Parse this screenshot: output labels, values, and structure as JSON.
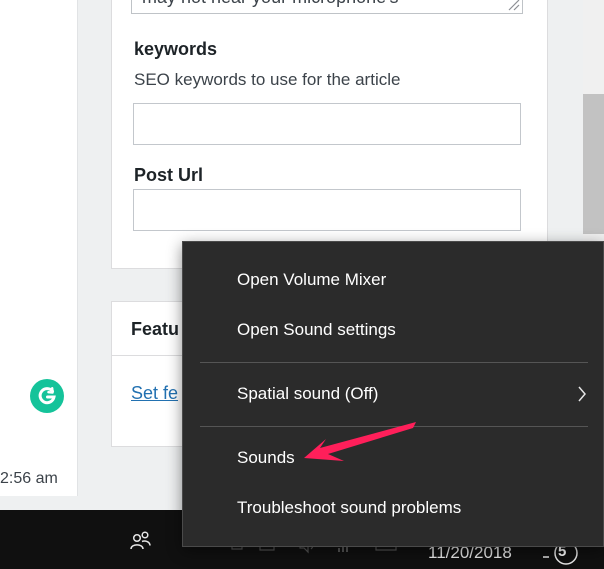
{
  "left_panel": {
    "time_text": "2:56 am"
  },
  "form": {
    "top_textarea_text": "may not hear your microphone's",
    "keywords_label": "keywords",
    "keywords_desc": "SEO keywords to use for the article",
    "post_url_label": "Post Url"
  },
  "featured": {
    "title": "Featu",
    "link": "Set fe"
  },
  "context_menu": {
    "items": [
      {
        "label": "Open Volume Mixer"
      },
      {
        "label": "Open Sound settings"
      },
      {
        "label": "Spatial sound (Off)",
        "has_submenu": true
      },
      {
        "label": "Sounds"
      },
      {
        "label": "Troubleshoot sound problems"
      }
    ]
  },
  "taskbar": {
    "date": "11/20/2018",
    "notification_count": "5",
    "icons": [
      "people-icon",
      "speaker-icon",
      "network-icon",
      "action-center-icon"
    ]
  },
  "colors": {
    "menu_bg": "#2b2b2b",
    "taskbar_bg": "#101010",
    "annotation_arrow": "#ff1f5a",
    "grammarly_green": "#15c39a",
    "link_blue": "#2271b1"
  }
}
